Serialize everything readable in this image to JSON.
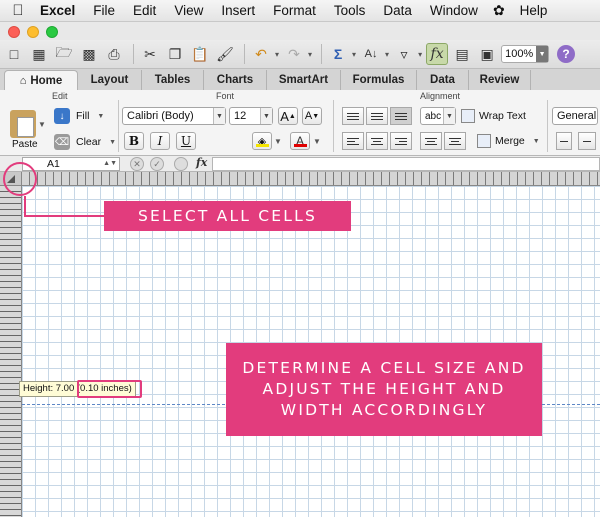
{
  "menubar": {
    "app_name": "Excel",
    "items": [
      "File",
      "Edit",
      "View",
      "Insert",
      "Format",
      "Tools",
      "Data",
      "Window",
      "Help"
    ]
  },
  "toolbar": {
    "zoom": "100%",
    "icons": [
      "new-icon",
      "templates-icon",
      "open-icon",
      "save-icon",
      "print-icon",
      "cut-icon",
      "copy-icon",
      "paste-icon",
      "format-painter-icon",
      "undo-icon",
      "redo-icon",
      "autosum-icon",
      "sort-icon",
      "filter-icon",
      "formula-builder-icon",
      "toolbox-icon",
      "media-icon",
      "help-icon"
    ]
  },
  "ribbon_tabs": [
    "Home",
    "Layout",
    "Tables",
    "Charts",
    "SmartArt",
    "Formulas",
    "Data",
    "Review"
  ],
  "ribbon": {
    "edit_group": "Edit",
    "font_group": "Font",
    "alignment_group": "Alignment",
    "paste_label": "Paste",
    "fill_label": "Fill",
    "clear_label": "Clear",
    "font_name": "Calibri (Body)",
    "font_size": "12",
    "bold": "B",
    "italic": "I",
    "underline": "U",
    "wrap_text": "Wrap Text",
    "merge": "Merge",
    "number_format": "General",
    "indent_label": "abc",
    "grow_font": "A",
    "shrink_font": "A",
    "font_color": "A"
  },
  "formula_bar": {
    "cell_ref": "A1",
    "fx": "fx",
    "value": ""
  },
  "tooltip": {
    "text_prefix": "Height: 7.00 ",
    "text_highlight": "(0.10 inches)"
  },
  "annotations": {
    "select_all": "SELECT ALL CELLS",
    "adjust": "DETERMINE A CELL SIZE AND ADJUST THE HEIGHT AND WIDTH ACCORDINGLY",
    "accent_color": "#e23c7d"
  }
}
